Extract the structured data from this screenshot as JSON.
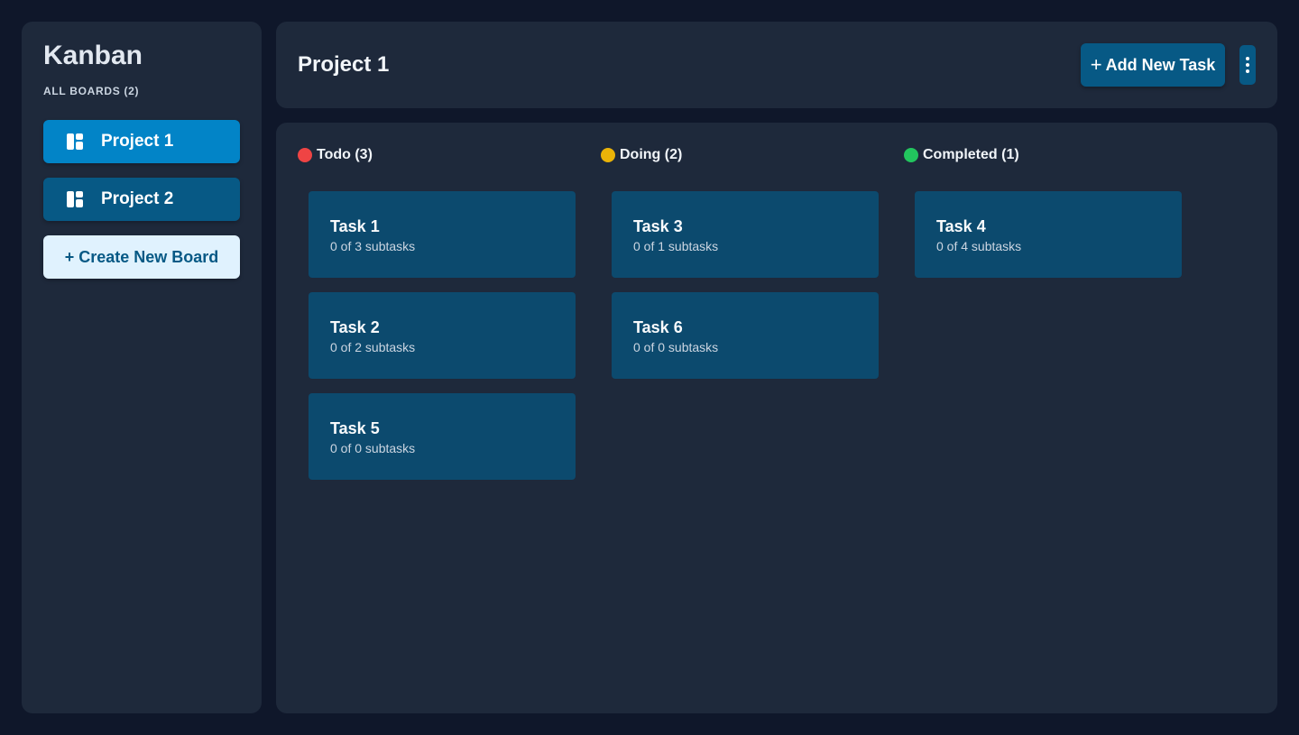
{
  "sidebar": {
    "app_title": "Kanban",
    "boards_heading": "ALL BOARDS (2)",
    "boards": [
      {
        "label": "Project 1",
        "active": true
      },
      {
        "label": "Project 2",
        "active": false
      }
    ],
    "create_label": "+ Create New Board"
  },
  "header": {
    "title": "Project 1",
    "add_task_plus": "+",
    "add_task_label": "Add New Task",
    "menu_icon": "vertical-ellipsis-icon"
  },
  "columns": [
    {
      "title": "Todo (3)",
      "color": "#ef4444",
      "tasks": [
        {
          "title": "Task 1",
          "subtasks": "0 of 3 subtasks"
        },
        {
          "title": "Task 2",
          "subtasks": "0 of 2 subtasks"
        },
        {
          "title": "Task 5",
          "subtasks": "0 of 0 subtasks"
        }
      ]
    },
    {
      "title": "Doing (2)",
      "color": "#eab308",
      "tasks": [
        {
          "title": "Task 3",
          "subtasks": "0 of 1 subtasks"
        },
        {
          "title": "Task 6",
          "subtasks": "0 of 0 subtasks"
        }
      ]
    },
    {
      "title": "Completed (1)",
      "color": "#22c55e",
      "tasks": [
        {
          "title": "Task 4",
          "subtasks": "0 of 4 subtasks"
        }
      ]
    }
  ],
  "colors": {
    "active_board": "#0284c7",
    "board": "#075985",
    "card": "#0c4a6e",
    "panel": "#1e293b",
    "background": "#0f172a"
  }
}
